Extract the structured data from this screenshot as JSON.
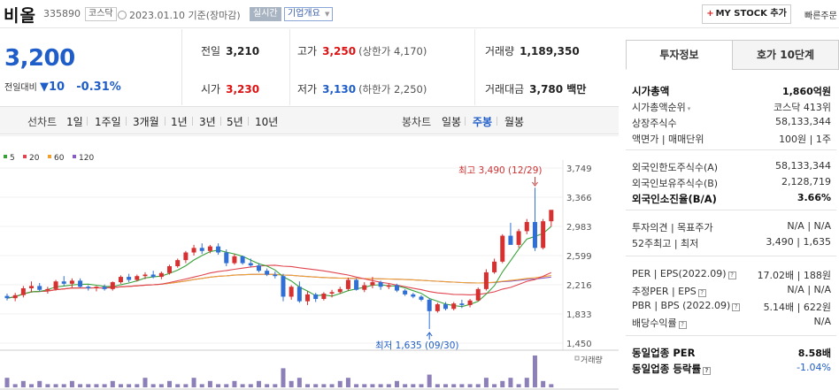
{
  "header": {
    "name": "비올",
    "code": "335890",
    "market": "코스닥",
    "date": "2023.01.10 기준(장마감)",
    "realtime": "실시간",
    "company_info": "기업개요",
    "my_stock": "MY STOCK 추가",
    "quick": "빠른주문"
  },
  "price": {
    "current": "3,200",
    "change_label": "전일대비",
    "change_value": "10",
    "change_pct": "-0.31%"
  },
  "stats": {
    "prev_label": "전일",
    "prev": "3,210",
    "open_label": "시가",
    "open": "3,230",
    "high_label": "고가",
    "high": "3,250",
    "upper_limit": "(상한가 4,170)",
    "low_label": "저가",
    "low": "3,130",
    "lower_limit": "(하한가 2,250)",
    "volume_label": "거래량",
    "volume": "1,189,350",
    "amount_label": "거래대금",
    "amount": "3,780 백만"
  },
  "period": {
    "line_label": "선차트",
    "line_items": [
      "1일",
      "1주일",
      "3개월",
      "1년",
      "3년",
      "5년",
      "10년"
    ],
    "candle_label": "봉차트",
    "candle_items": [
      "일봉",
      "주봉",
      "월봉"
    ],
    "selected_candle": "주봉"
  },
  "chart_data": {
    "type": "candlestick",
    "period": "weekly",
    "legend": [
      "5",
      "20",
      "60",
      "120"
    ],
    "legend_colors": [
      "#3aa13a",
      "#e0454f",
      "#f0a030",
      "#8a5cc2"
    ],
    "y_ticks": [
      "3,749",
      "3,366",
      "2,983",
      "2,599",
      "2,216",
      "1,833",
      "1,450"
    ],
    "ylim": [
      1450,
      3749
    ],
    "annotations": {
      "high": "최고 3,490 (12/29)",
      "low": "최저 1,635 (09/30)"
    },
    "volume_label": "거래량",
    "candles": [
      [
        2070,
        2100,
        2010,
        2040
      ],
      [
        2040,
        2110,
        2000,
        2080
      ],
      [
        2080,
        2200,
        2050,
        2170
      ],
      [
        2170,
        2260,
        2120,
        2200
      ],
      [
        2200,
        2240,
        2130,
        2150
      ],
      [
        2150,
        2190,
        2100,
        2160
      ],
      [
        2160,
        2280,
        2140,
        2260
      ],
      [
        2260,
        2330,
        2200,
        2230
      ],
      [
        2230,
        2300,
        2180,
        2270
      ],
      [
        2270,
        2300,
        2180,
        2190
      ],
      [
        2190,
        2210,
        2140,
        2170
      ],
      [
        2170,
        2200,
        2130,
        2190
      ],
      [
        2190,
        2220,
        2140,
        2160
      ],
      [
        2160,
        2260,
        2140,
        2250
      ],
      [
        2250,
        2340,
        2230,
        2320
      ],
      [
        2320,
        2360,
        2250,
        2280
      ],
      [
        2280,
        2350,
        2260,
        2330
      ],
      [
        2330,
        2380,
        2290,
        2350
      ],
      [
        2350,
        2400,
        2300,
        2320
      ],
      [
        2320,
        2390,
        2290,
        2370
      ],
      [
        2370,
        2480,
        2350,
        2460
      ],
      [
        2460,
        2560,
        2440,
        2540
      ],
      [
        2540,
        2660,
        2500,
        2640
      ],
      [
        2640,
        2740,
        2600,
        2700
      ],
      [
        2700,
        2760,
        2620,
        2660
      ],
      [
        2660,
        2740,
        2630,
        2720
      ],
      [
        2720,
        2760,
        2610,
        2640
      ],
      [
        2640,
        2680,
        2460,
        2500
      ],
      [
        2500,
        2620,
        2480,
        2590
      ],
      [
        2590,
        2600,
        2480,
        2500
      ],
      [
        2500,
        2560,
        2450,
        2470
      ],
      [
        2470,
        2500,
        2380,
        2400
      ],
      [
        2400,
        2430,
        2330,
        2350
      ],
      [
        2350,
        2390,
        2300,
        2330
      ],
      [
        2330,
        2360,
        2000,
        2060
      ],
      [
        2060,
        2210,
        2020,
        2190
      ],
      [
        2190,
        2260,
        1980,
        2000
      ],
      [
        2000,
        2130,
        1950,
        2090
      ],
      [
        2090,
        2110,
        1990,
        2030
      ],
      [
        2030,
        2120,
        2010,
        2100
      ],
      [
        2100,
        2150,
        2050,
        2120
      ],
      [
        2120,
        2190,
        2100,
        2160
      ],
      [
        2160,
        2310,
        2140,
        2280
      ],
      [
        2280,
        2300,
        2140,
        2150
      ],
      [
        2150,
        2250,
        2120,
        2210
      ],
      [
        2210,
        2320,
        2170,
        2250
      ],
      [
        2250,
        2270,
        2150,
        2190
      ],
      [
        2190,
        2230,
        2160,
        2210
      ],
      [
        2210,
        2230,
        2120,
        2140
      ],
      [
        2140,
        2160,
        2070,
        2090
      ],
      [
        2090,
        2110,
        2040,
        2060
      ],
      [
        2060,
        2080,
        2000,
        2020
      ],
      [
        2020,
        2040,
        1635,
        1870
      ],
      [
        1870,
        1980,
        1850,
        1960
      ],
      [
        1960,
        1990,
        1880,
        1900
      ],
      [
        1900,
        1990,
        1880,
        1970
      ],
      [
        1970,
        2020,
        1910,
        1950
      ],
      [
        1950,
        2030,
        1920,
        2010
      ],
      [
        2010,
        2180,
        2000,
        2160
      ],
      [
        2160,
        2420,
        2140,
        2380
      ],
      [
        2380,
        2560,
        2360,
        2520
      ],
      [
        2520,
        2880,
        2500,
        2860
      ],
      [
        2860,
        3030,
        2820,
        2740
      ],
      [
        2740,
        2950,
        2700,
        2920
      ],
      [
        2920,
        3080,
        2880,
        3040
      ],
      [
        3040,
        3490,
        2660,
        2700
      ],
      [
        2700,
        3080,
        2680,
        3050
      ],
      [
        3050,
        3170,
        2980,
        3200
      ]
    ],
    "volumes": [
      3,
      1,
      2,
      1,
      2,
      1,
      1,
      1,
      2,
      1,
      1,
      1,
      1,
      2,
      1,
      1,
      1,
      3,
      1,
      1,
      2,
      1,
      1,
      3,
      1,
      2,
      1,
      1,
      2,
      1,
      1,
      2,
      1,
      1,
      6,
      2,
      3,
      1,
      1,
      1,
      1,
      2,
      3,
      1,
      1,
      1,
      1,
      1,
      2,
      1,
      1,
      1,
      4,
      1,
      1,
      1,
      1,
      1,
      1,
      3,
      1,
      2,
      3,
      1,
      3,
      10,
      2,
      1
    ]
  },
  "invest": {
    "tab1": "투자정보",
    "tab2": "호가 10단계",
    "rows": [
      {
        "k": "시가총액",
        "v": "1,860억원",
        "style": "bold"
      },
      {
        "k": "시가총액순위",
        "v": "코스닥 413위"
      },
      {
        "k": "상장주식수",
        "v": "58,133,344"
      },
      {
        "k": "액면가 | 매매단위",
        "v": "100원 | 1주"
      },
      {
        "k": "외국인한도주식수(A)",
        "v": "58,133,344"
      },
      {
        "k": "외국인보유주식수(B)",
        "v": "2,128,719"
      },
      {
        "k": "외국인소진율(B/A)",
        "v": "3.66%",
        "style": "bold"
      },
      {
        "k": "투자의견 | 목표주가",
        "v": "N/A | N/A"
      },
      {
        "k": "52주최고 | 최저",
        "v": "3,490 | 1,635"
      },
      {
        "k": "PER | EPS(2022.09)",
        "v": "17.02배 | 188원"
      },
      {
        "k": "추정PER | EPS",
        "v": "N/A | N/A"
      },
      {
        "k": "PBR | BPS (2022.09)",
        "v": "5.14배 | 622원"
      },
      {
        "k": "배당수익률",
        "v": "N/A"
      },
      {
        "k": "동일업종 PER",
        "v": "8.58배",
        "style": "bold"
      },
      {
        "k": "동일업종 등락률",
        "v": "-1.04%",
        "style": "blue"
      }
    ]
  }
}
